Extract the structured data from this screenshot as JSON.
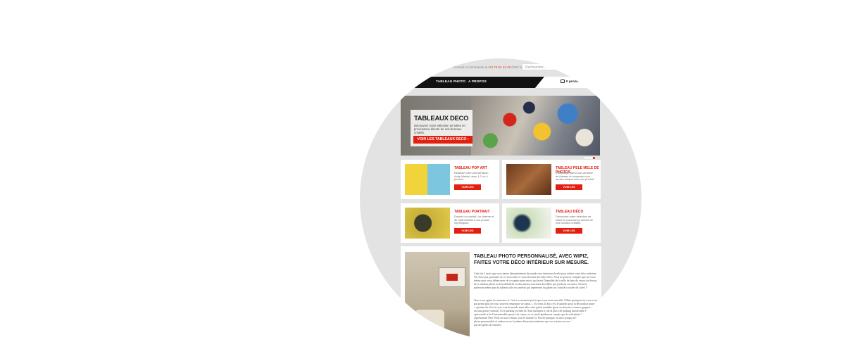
{
  "topbar": {
    "contact_prefix": "Conseil et commande au",
    "phone": "04 73 61 42 40",
    "contact_suffix": "(Tarif local)",
    "search_placeholder": "Rechercher..."
  },
  "nav": {
    "items": [
      "TABLEAU PHOTO",
      "A PROPOS"
    ],
    "cart_label": "0 produits"
  },
  "hero": {
    "title": "TABLEAUX DECO",
    "subtitle": "Découvrez notre sélection de toiles en provenance directe de nos bureaux créatifs.",
    "button": "VOIR LES TABLEAUX DECO",
    "slide_count": 4,
    "active_slide": 4
  },
  "cards": [
    {
      "title": "TABLEAU POP ART",
      "desc": "Réalisez votre portrait façon Andy Warhol, avec 1,2 ou 4 photos!",
      "button": "VOIR LES TABLEAUX"
    },
    {
      "title": "TABLEAU PELE MELE DE PHOTOS",
      "desc": "Choisissez parmi une centaine de thèmes et composez une oeuvre unique avec vos photos!",
      "button": "VOIR LES TABLEAUX"
    },
    {
      "title": "TABLEAU PORTRAIT",
      "desc": "Donnez du cachet, du charme et de l'authenticité à vos photos numériques.",
      "button": "VOIR LES TABLEAUX"
    },
    {
      "title": "TABLEAU DÉCO",
      "desc": "Découvrez notre sélection de toiles et provenance directe de nos bureaux créatifs.",
      "button": "VOIR LES TABLEAUX"
    }
  ],
  "article": {
    "title": "TABLEAU PHOTO PERSONNALISÉ, AVEC WIPIZ, FAITES VOTRE DÉCO INTÉRIEUR SUR MESURE.",
    "p1": "Cela fait 3 mois que vous tentez désespérément de joindre une émission de télé pour refaire votre déco intérieur. Ne rêvez pas, personne ne va vous aider et vous devenez des idées déco. Vous ne pouvez compter que sur vous-même pour vous débarrasser de ce papier peint moisi qui ternit l'humidité de la salle de bain du retour du dessus, de ce tableau photo au bois défraîchi ou des photos souvenirs décollées qui jonchent vos murs. Nous ne parlerons même pas du tableau toile en canevas qui représente du gibier sur fond de coucher de soleil !!",
    "p2": "Vous vous agitez les neurones et c'est à ce moment précis que vous vient une idée ! Mais pourquoi n'y avez-vous pas pensé plus tôt vous trouvez remarquer vos amis. « Tu verra, là bas c'est le paradis pour la décoration maison » ajoutent du fil c'est vrai, tout le monde aime aller chez galeti meubles (pour ses biscuits et autres grignotages en tous genres surtout). Et le parking est bien là. Sauf quelques ici de la place de parking introuvable le samedi après-midi et de l'interminable queue à la caisse, on se rend rapidement compte que la toile photo kitch « représentant New-York en noir et blanc, tout le monde l'a. Pas de panique, on mes sympa, mais mêmes tableau photo personnalisé et cadeau avoir la même décoration intérieur que vos voisins ne vous ? sait que vous n'avez pas des goûts de chiottes."
  }
}
